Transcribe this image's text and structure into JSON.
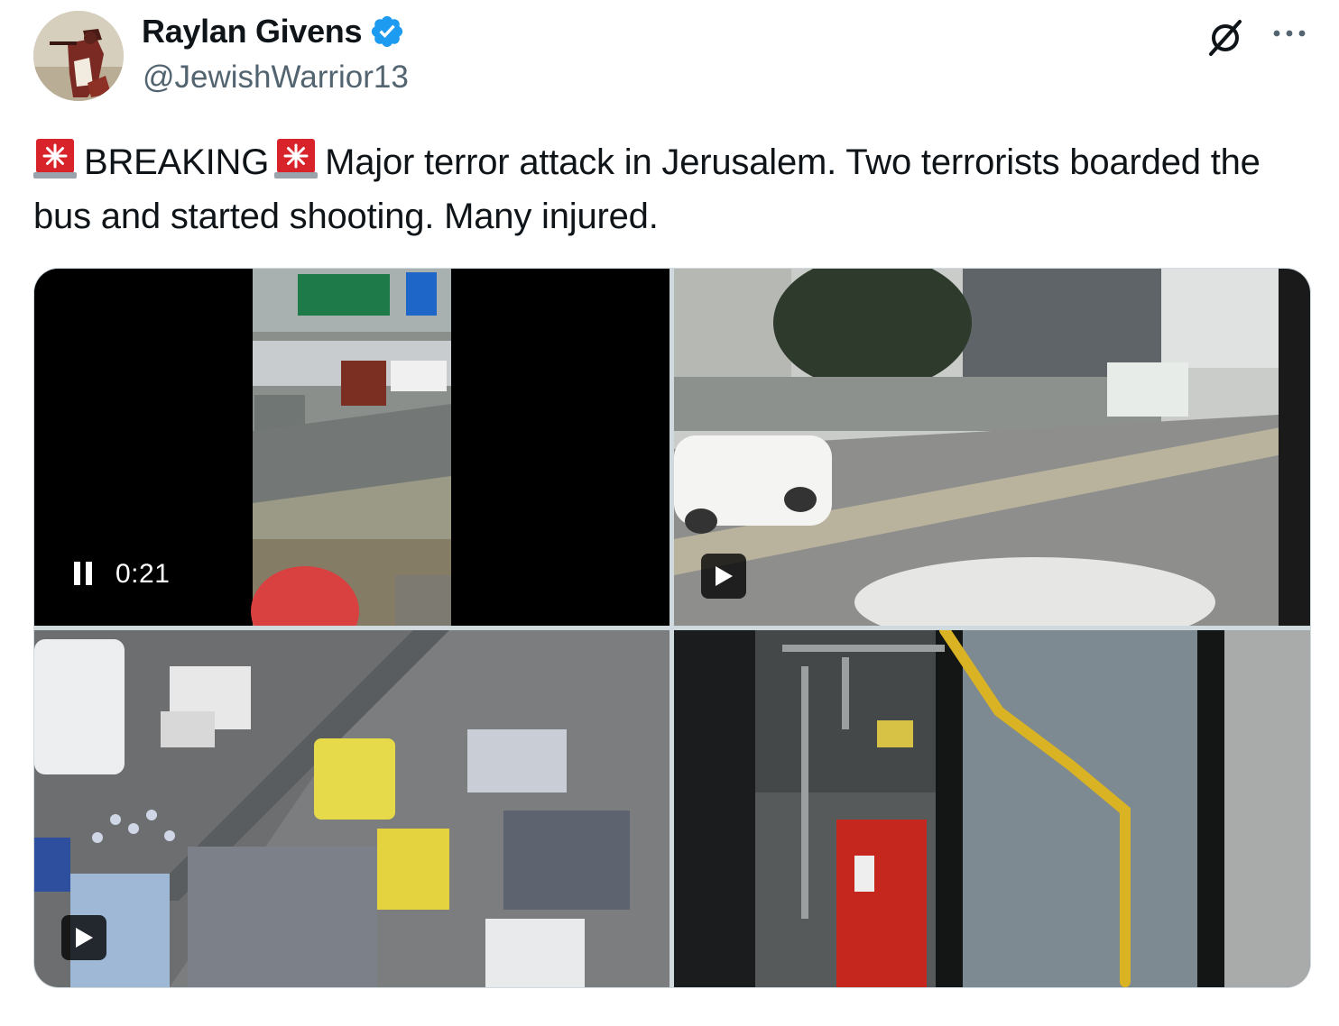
{
  "author": {
    "display_name": "Raylan Givens",
    "handle": "@JewishWarrior13",
    "verified": true
  },
  "tweet": {
    "tag": "BREAKING",
    "text": "Major terror attack in Jerusalem. Two terrorists boarded the bus and started shooting. Many injured."
  },
  "media": {
    "video1": {
      "duration": "0:21",
      "state": "playing"
    },
    "items": [
      {
        "kind": "video"
      },
      {
        "kind": "video"
      },
      {
        "kind": "video"
      },
      {
        "kind": "photo"
      }
    ]
  },
  "colors": {
    "text": "#0f1419",
    "secondary": "#536471",
    "verified": "#1d9bf0",
    "border": "#cfd9de",
    "siren": "#d8232a"
  },
  "icons": [
    "verified-badge-icon",
    "grok-icon",
    "more-options-icon",
    "siren-emoji-icon",
    "pause-icon",
    "play-icon"
  ]
}
